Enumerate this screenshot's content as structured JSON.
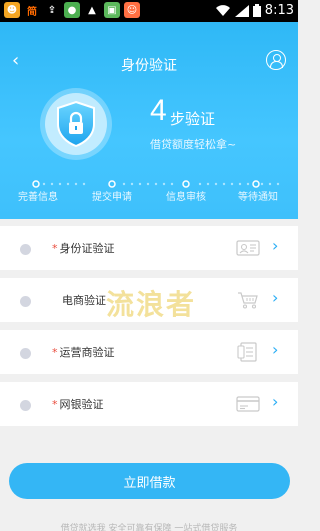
{
  "status_bar": {
    "time": "8:13",
    "left_icons": [
      {
        "name": "app-icon-1",
        "color": "#f5a623"
      },
      {
        "name": "simplified-chinese-icon",
        "text": "简",
        "color": "#ff6a00"
      },
      {
        "name": "upload-icon",
        "color": "#555555"
      },
      {
        "name": "app-icon-green",
        "color": "#4caf50"
      },
      {
        "name": "warning-icon",
        "color": "#dddddd"
      },
      {
        "name": "app-icon-gallery",
        "color": "#5cb85c"
      },
      {
        "name": "app-icon-face",
        "color": "#ff7043"
      }
    ]
  },
  "header": {
    "title": "身份验证",
    "steps_number": "4",
    "steps_label": "步验证",
    "steps_sub": "借贷额度轻松拿~",
    "progress_labels": [
      "完善信息",
      "提交申请",
      "信息审核",
      "等待通知"
    ]
  },
  "verification_items": [
    {
      "label": "身份证验证",
      "required": "*",
      "icon": "id-card-icon"
    },
    {
      "label": "电商验证",
      "required": "",
      "icon": "shopping-cart-icon"
    },
    {
      "label": "运营商验证",
      "required": "*",
      "icon": "phone-bill-icon"
    },
    {
      "label": "网银验证",
      "required": "*",
      "icon": "bank-card-icon"
    }
  ],
  "watermark": "流浪者",
  "cta_label": "立即借款",
  "footer_text": "借贷就选我 安全可靠有保障 一站式借贷服务"
}
